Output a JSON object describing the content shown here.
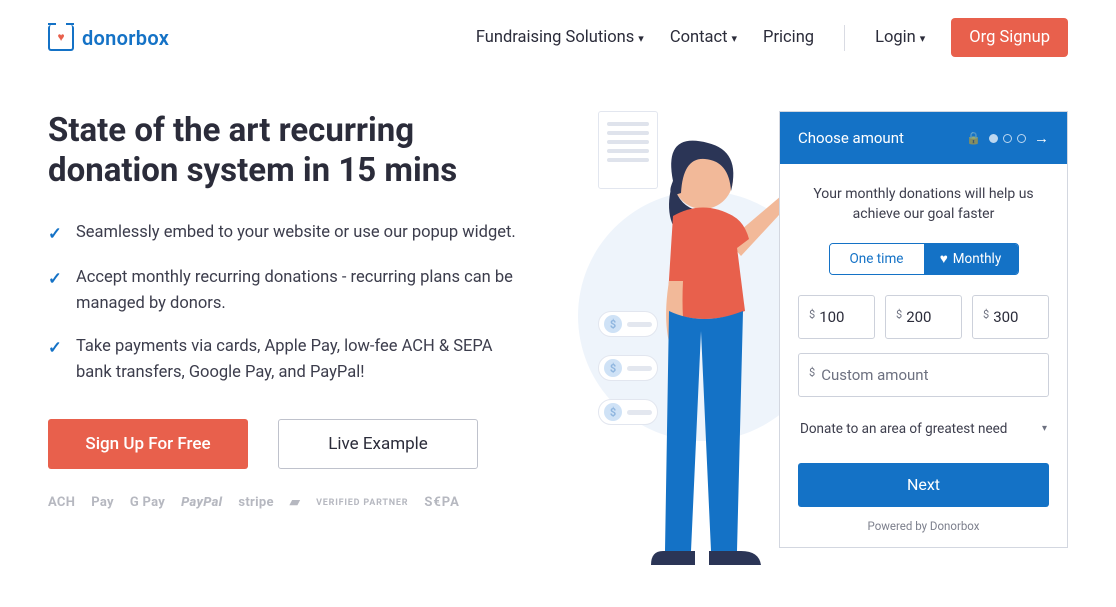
{
  "header": {
    "logo_text": "donorbox",
    "nav": {
      "fundraising": "Fundraising Solutions",
      "contact": "Contact",
      "pricing": "Pricing",
      "login": "Login",
      "org_signup": "Org Signup"
    }
  },
  "hero": {
    "title": "State of the art recurring donation system in 15 mins",
    "features": [
      "Seamlessly embed to your website or use our popup widget.",
      "Accept monthly recurring donations - recurring plans can be managed by donors.",
      "Take payments via cards, Apple Pay, low-fee ACH & SEPA bank transfers, Google Pay, and PayPal!"
    ],
    "cta_primary": "Sign Up For Free",
    "cta_secondary": "Live Example",
    "partners": {
      "ach": "ACH",
      "apple_pay": "Pay",
      "google_pay": "G Pay",
      "paypal": "PayPal",
      "stripe": "stripe",
      "verified": "VERIFIED PARTNER",
      "sepa": "S€PA"
    }
  },
  "widget": {
    "head": "Choose amount",
    "message": "Your monthly donations will help us achieve our goal faster",
    "freq": {
      "one_time": "One time",
      "monthly": "Monthly"
    },
    "currency": "$",
    "amounts": [
      "100",
      "200",
      "300"
    ],
    "custom_placeholder": "Custom amount",
    "dropdown": "Donate to an area of greatest need",
    "next": "Next",
    "powered": "Powered by Donorbox"
  }
}
